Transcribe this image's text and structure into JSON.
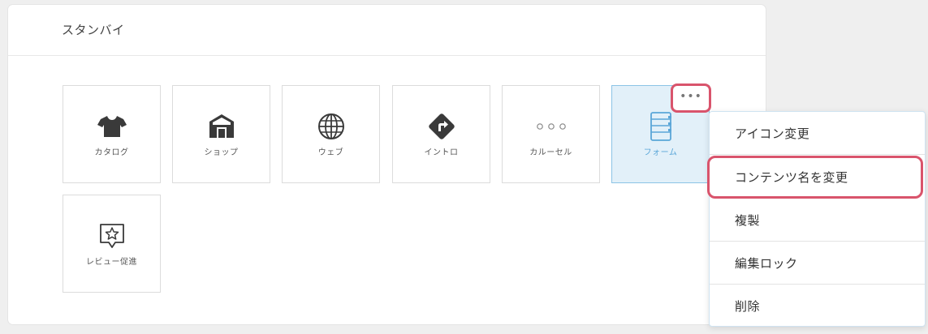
{
  "panel": {
    "title": "スタンバイ"
  },
  "tiles": [
    {
      "label": "カタログ",
      "icon": "tshirt-icon"
    },
    {
      "label": "ショップ",
      "icon": "shop-icon"
    },
    {
      "label": "ウェブ",
      "icon": "globe-icon"
    },
    {
      "label": "イントロ",
      "icon": "direction-sign-icon"
    },
    {
      "label": "カルーセル",
      "icon": "carousel-dots-icon"
    },
    {
      "label": "フォーム",
      "icon": "form-notebook-icon",
      "selected": true
    },
    {
      "label": "レビュー促進",
      "icon": "review-star-icon"
    }
  ],
  "more_button": {
    "label": "•••"
  },
  "context_menu": {
    "items": [
      {
        "label": "アイコン変更"
      },
      {
        "label": "コンテンツ名を変更",
        "highlighted": true
      },
      {
        "label": "複製"
      },
      {
        "label": "編集ロック"
      },
      {
        "label": "削除"
      }
    ]
  },
  "colors": {
    "highlight_border": "#d9546c",
    "selected_tile_bg": "#e2f0f9",
    "selected_tile_border": "#8cc4e6",
    "icon_dark": "#3a3a3a"
  }
}
